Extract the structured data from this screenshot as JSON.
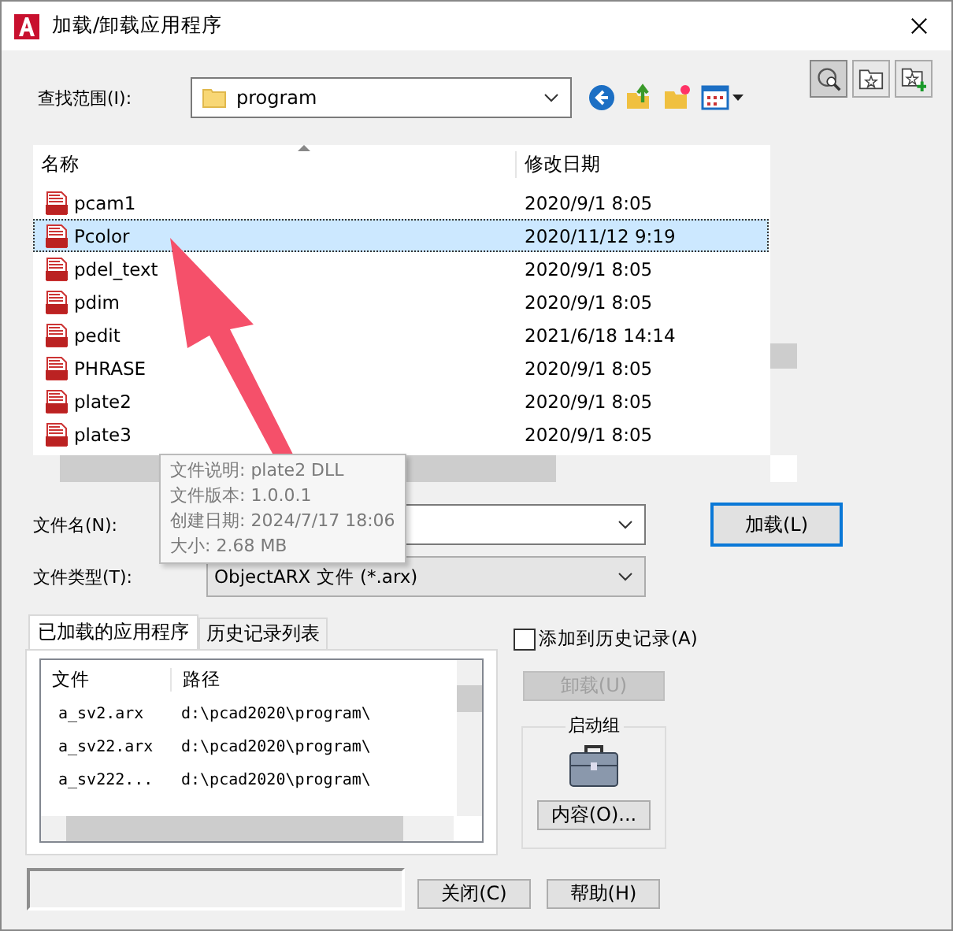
{
  "window": {
    "title": "加载/卸载应用程序"
  },
  "look_in": {
    "label": "查找范围(I):",
    "value": "program"
  },
  "file_list": {
    "columns": [
      "名称",
      "修改日期"
    ],
    "rows": [
      {
        "name": "pcam1",
        "date": "2020/9/1 8:05",
        "selected": false
      },
      {
        "name": "Pcolor",
        "date": "2020/11/12 9:19",
        "selected": true
      },
      {
        "name": "pdel_text",
        "date": "2020/9/1 8:05",
        "selected": false
      },
      {
        "name": "pdim",
        "date": "2020/9/1 8:05",
        "selected": false
      },
      {
        "name": "pedit",
        "date": "2021/6/18 14:14",
        "selected": false
      },
      {
        "name": "PHRASE",
        "date": "2020/9/1 8:05",
        "selected": false
      },
      {
        "name": "plate2",
        "date": "2020/9/1 8:05",
        "selected": false
      },
      {
        "name": "plate3",
        "date": "2020/9/1 8:05",
        "selected": false
      }
    ]
  },
  "tooltip": [
    "文件说明: plate2 DLL",
    "文件版本: 1.0.0.1",
    "创建日期: 2024/7/17 18:06",
    "大小: 2.68 MB"
  ],
  "file_name": {
    "label": "文件名(N):"
  },
  "load_button": "加载(L)",
  "file_type": {
    "label": "文件类型(T):",
    "value": "ObjectARX 文件 (*.arx)"
  },
  "tabs": [
    {
      "label": "已加载的应用程序",
      "selected": true
    },
    {
      "label": "历史记录列表",
      "selected": false
    }
  ],
  "loaded_list": {
    "columns": [
      "文件",
      "路径"
    ],
    "rows": [
      {
        "file": "a_sv2.arx",
        "path": "d:\\pcad2020\\program\\"
      },
      {
        "file": "a_sv22.arx",
        "path": "d:\\pcad2020\\program\\"
      },
      {
        "file": "a_sv222...",
        "path": "d:\\pcad2020\\program\\"
      }
    ]
  },
  "add_to_history": {
    "label": "添加到历史记录(A)",
    "checked": false
  },
  "unload_button": {
    "label": "卸载(U)",
    "disabled": true
  },
  "startup_group": {
    "title": "启动组",
    "button": "内容(O)..."
  },
  "buttons": [
    "关闭(C)",
    "帮助(H)"
  ]
}
